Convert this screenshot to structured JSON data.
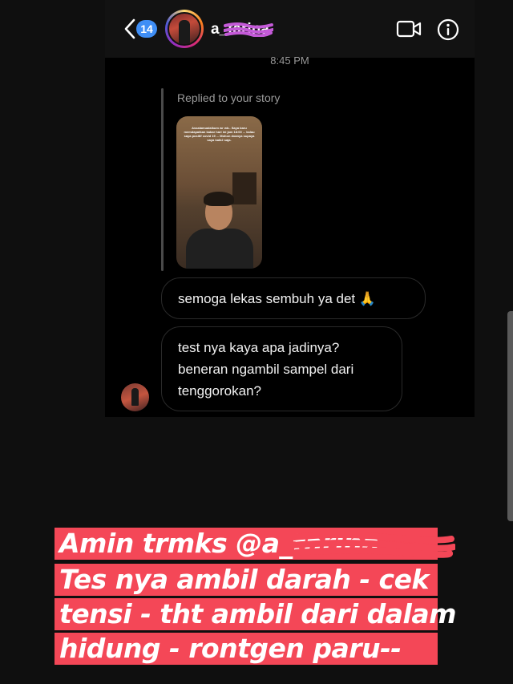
{
  "header": {
    "unread_count": "14",
    "username": "a_tarina",
    "back_icon": "chevron-left-icon",
    "video_icon": "video-camera-icon",
    "info_icon": "info-icon"
  },
  "thread": {
    "timestamp": "8:45 PM",
    "reply_label": "Replied to your story",
    "story_text": "Assalamualaikum wr wb.. Saya baru memdapatkan kabar hari ini jam 18:00 ... kalau saya positif covid 19 ... Mohon doanya supaya saya baik2 saja.",
    "messages": [
      {
        "text": "semoga lekas sembuh ya det 🙏"
      },
      {
        "lines": [
          "test nya kaya apa jadinya?",
          "beneran ngambil sampel dari",
          "tenggorokan?"
        ]
      }
    ]
  },
  "captions": [
    "Amin trmks @a_tarina",
    "Tes nya ambil darah - cek",
    "tensi - tht ambil dari dalam",
    "hidung - rontgen paru--"
  ],
  "colors": {
    "caption_bg": "#f44757",
    "badge_bg": "#3f8ef5",
    "scribble": "#c45ad8"
  }
}
